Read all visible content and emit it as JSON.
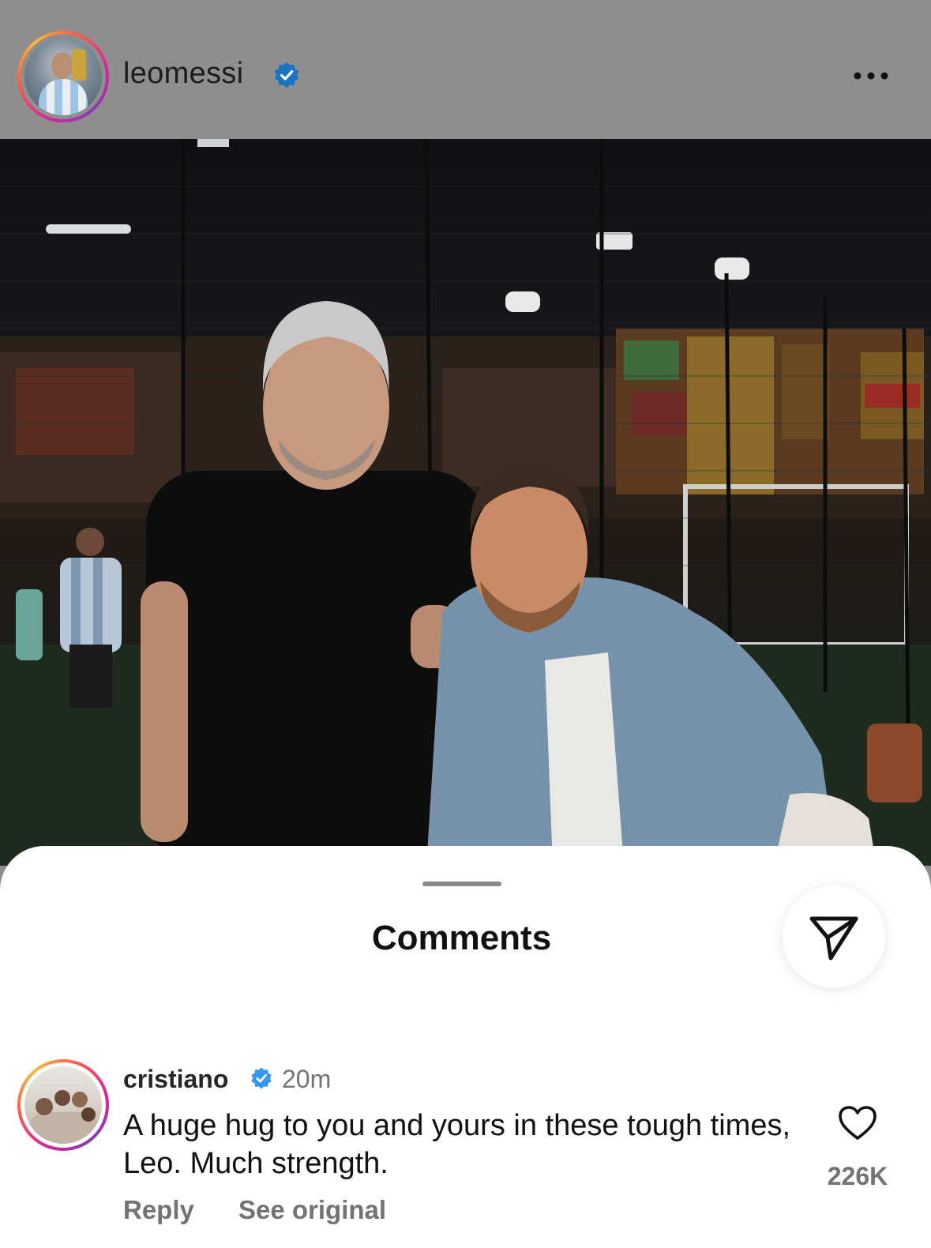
{
  "post": {
    "author": "leomessi",
    "author_verified": true,
    "more_icon": "more-horizontal-icon"
  },
  "comments_sheet": {
    "title": "Comments",
    "share_icon": "send-icon"
  },
  "comments": [
    {
      "user": "cristiano",
      "verified": true,
      "time": "20m",
      "text": "A huge hug to you and yours in these tough times, Leo. Much strength.",
      "reply_label": "Reply",
      "see_original_label": "See original",
      "like_icon": "heart-outline-icon",
      "likes": "226K"
    }
  ],
  "colors": {
    "overlay_gray": "#8e8e8e",
    "verified_blue": "#3897f0",
    "secondary_text": "#737373"
  }
}
